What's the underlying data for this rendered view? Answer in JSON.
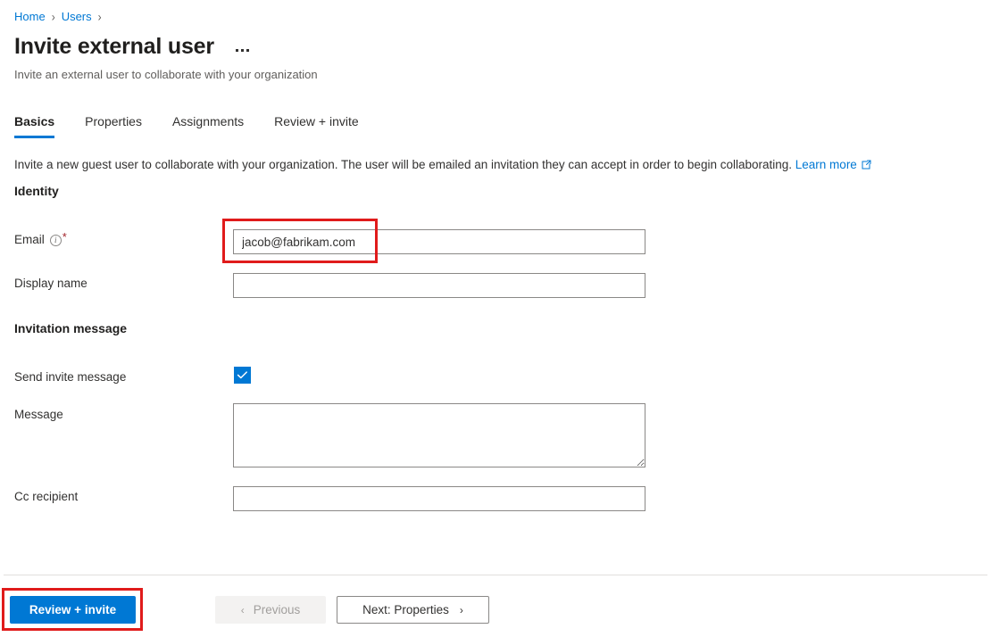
{
  "breadcrumb": {
    "items": [
      {
        "label": "Home"
      },
      {
        "label": "Users"
      }
    ],
    "separator": "›"
  },
  "header": {
    "title": "Invite external user",
    "subtitle": "Invite an external user to collaborate with your organization",
    "more_menu": "more-commands"
  },
  "tabs": [
    {
      "label": "Basics",
      "active": true
    },
    {
      "label": "Properties",
      "active": false
    },
    {
      "label": "Assignments",
      "active": false
    },
    {
      "label": "Review + invite",
      "active": false
    }
  ],
  "intro": {
    "text": "Invite a new guest user to collaborate with your organization. The user will be emailed an invitation they can accept in order to begin collaborating.",
    "link_label": "Learn more"
  },
  "sections": {
    "identity": {
      "heading": "Identity",
      "fields": {
        "email": {
          "label": "Email",
          "value": "jacob@fabrikam.com",
          "placeholder": "",
          "required_marker": "*",
          "info_glyph": "i"
        },
        "display_name": {
          "label": "Display name",
          "value": "",
          "placeholder": ""
        }
      }
    },
    "invitation_message": {
      "heading": "Invitation message",
      "fields": {
        "send_invite_message": {
          "label": "Send invite message",
          "checked": true
        },
        "message": {
          "label": "Message",
          "value": "",
          "placeholder": ""
        },
        "cc_recipient": {
          "label": "Cc recipient",
          "value": "",
          "placeholder": ""
        }
      }
    }
  },
  "footer": {
    "review_invite_label": "Review + invite",
    "previous_label": "Previous",
    "previous_chevron": "‹",
    "next_label": "Next: Properties",
    "next_chevron": "›"
  },
  "annotations": {
    "color": "#e01b1b",
    "targets": [
      "email-input",
      "review-invite-button"
    ]
  }
}
